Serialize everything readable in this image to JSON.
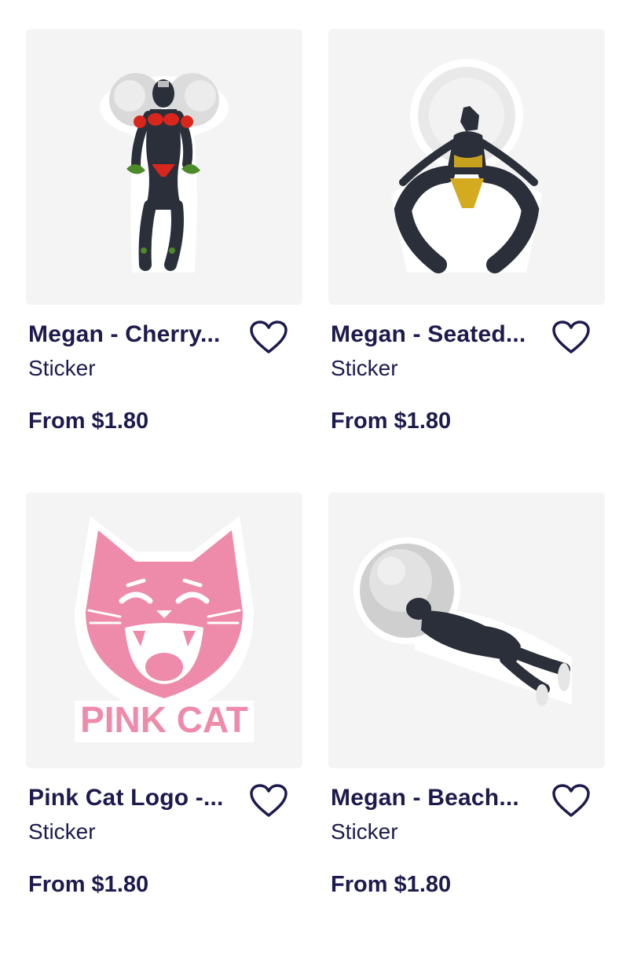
{
  "products": [
    {
      "title": "Megan - Cherry...",
      "type": "Sticker",
      "price": "From $1.80",
      "image_icon": "sticker-character-cherry-image"
    },
    {
      "title": "Megan - Seated...",
      "type": "Sticker",
      "price": "From $1.80",
      "image_icon": "sticker-character-seated-image"
    },
    {
      "title": "Pink Cat Logo -...",
      "type": "Sticker",
      "price": "From $1.80",
      "image_icon": "sticker-pink-cat-logo-image",
      "logo_text": "PINK CAT"
    },
    {
      "title": "Megan - Beach...",
      "type": "Sticker",
      "price": "From $1.80",
      "image_icon": "sticker-character-beach-image"
    }
  ],
  "colors": {
    "text": "#1d1a4d",
    "thumb_bg": "#f4f4f5",
    "logo_pink": "#ee8aaa",
    "heart_stroke": "#1d1a4d"
  }
}
